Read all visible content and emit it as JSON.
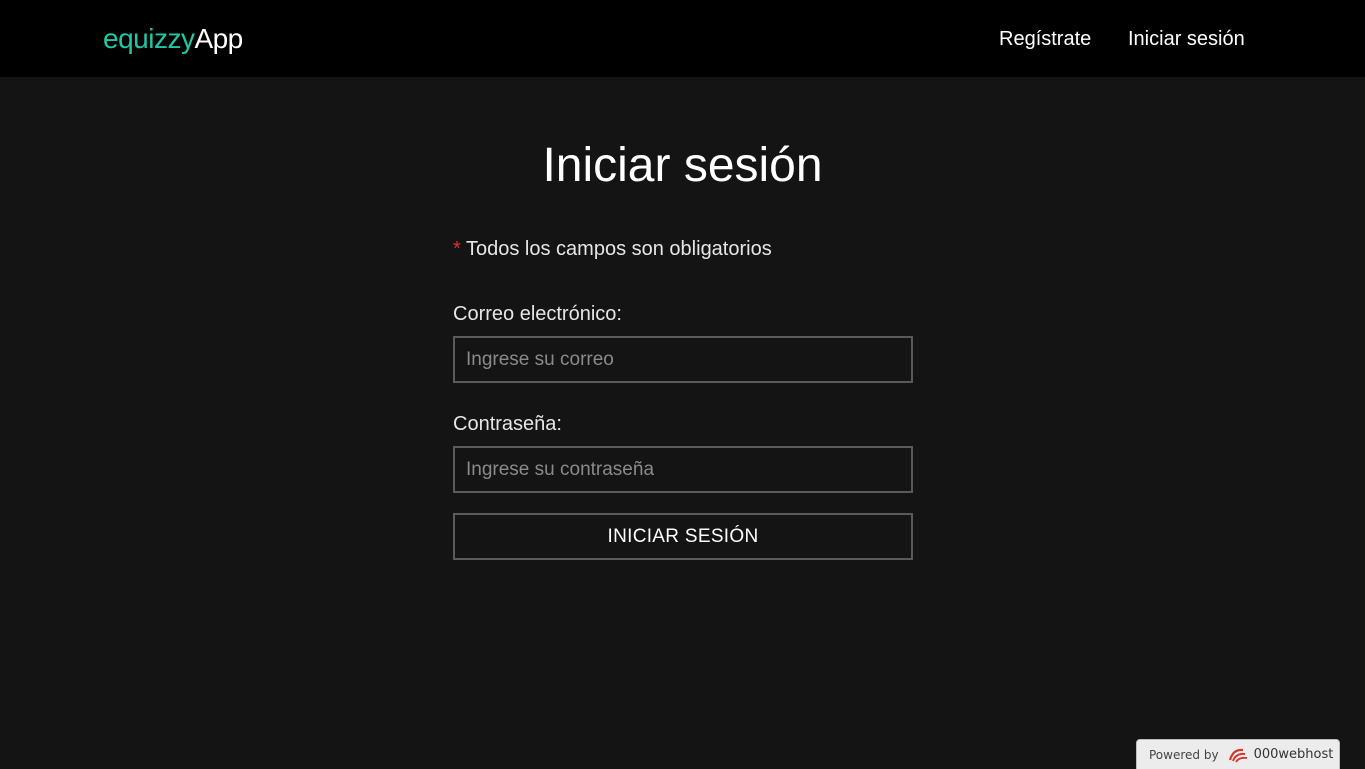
{
  "navbar": {
    "brand_part1": "equizzy",
    "brand_part2": "App",
    "links": [
      {
        "label": "Regístrate"
      },
      {
        "label": "Iniciar sesión"
      }
    ]
  },
  "form": {
    "title": "Iniciar sesión",
    "required_asterisk": "*",
    "required_note": " Todos los campos son obligatorios",
    "email_label": "Correo electrónico:",
    "email_placeholder": "Ingrese su correo",
    "email_value": "",
    "password_label": "Contraseña:",
    "password_placeholder": "Ingrese su contraseña",
    "password_value": "",
    "submit_label": "INICIAR SESIÓN"
  },
  "footer_badge": {
    "powered_by": "Powered by",
    "host_name": "000webhost"
  },
  "colors": {
    "brand_accent": "#1fc7a4",
    "navbar_bg": "#000000",
    "page_bg": "#141414",
    "required_mark": "#e03030"
  },
  "icons": {
    "host_logo": "000webhost-logo-icon"
  }
}
